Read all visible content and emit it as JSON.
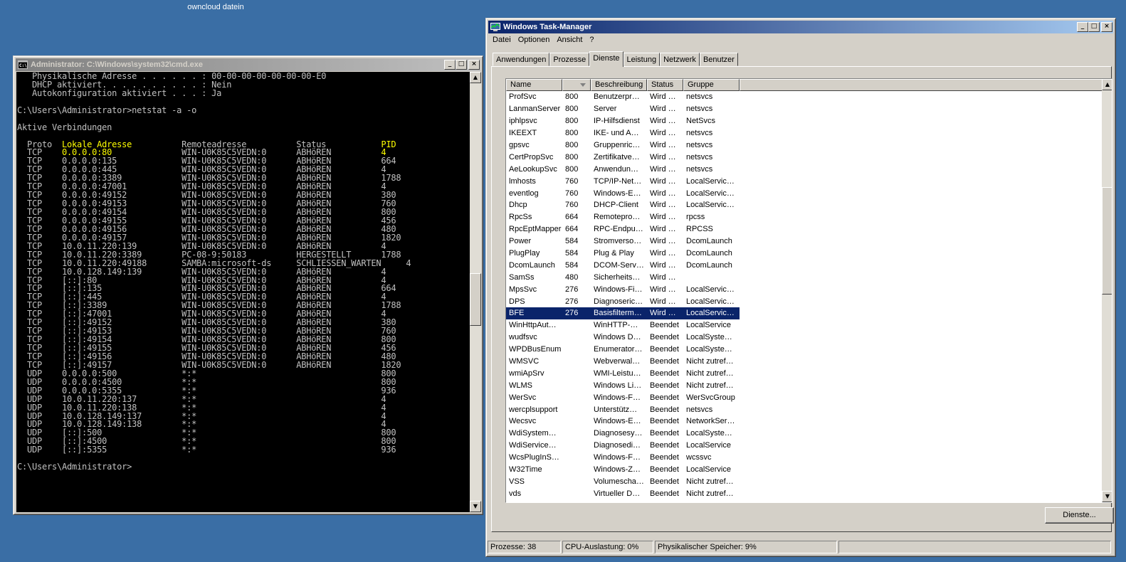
{
  "desktop": {
    "icon_label": "owncloud datein"
  },
  "cmd": {
    "title": "Administrator: C:\\Windows\\system32\\cmd.exe",
    "buttons": {
      "minimize": "_",
      "maximize": "□",
      "close": "×"
    },
    "lines": [
      "   Physikalische Adresse . . . . . . : 00-00-00-00-00-00-00-E0",
      "   DHCP aktiviert. . . . . . . . . . : Nein",
      "   Autokonfiguration aktiviert . . . : Ja",
      "",
      "C:\\Users\\Administrator>netstat -a -o",
      "",
      "Aktive Verbindungen",
      "",
      "  Proto  Lokale Adresse          Remoteadresse          Status           PID",
      "  TCP    0.0.0.0:80              WIN-U0K85C5VEDN:0      ABHöREN          4",
      "  TCP    0.0.0.0:135             WIN-U0K85C5VEDN:0      ABHöREN          664",
      "  TCP    0.0.0.0:445             WIN-U0K85C5VEDN:0      ABHöREN          4",
      "  TCP    0.0.0.0:3389            WIN-U0K85C5VEDN:0      ABHöREN          1788",
      "  TCP    0.0.0.0:47001           WIN-U0K85C5VEDN:0      ABHöREN          4",
      "  TCP    0.0.0.0:49152           WIN-U0K85C5VEDN:0      ABHöREN          380",
      "  TCP    0.0.0.0:49153           WIN-U0K85C5VEDN:0      ABHöREN          760",
      "  TCP    0.0.0.0:49154           WIN-U0K85C5VEDN:0      ABHöREN          800",
      "  TCP    0.0.0.0:49155           WIN-U0K85C5VEDN:0      ABHöREN          456",
      "  TCP    0.0.0.0:49156           WIN-U0K85C5VEDN:0      ABHöREN          480",
      "  TCP    0.0.0.0:49157           WIN-U0K85C5VEDN:0      ABHöREN          1820",
      "  TCP    10.0.11.220:139         WIN-U0K85C5VEDN:0      ABHöREN          4",
      "  TCP    10.0.11.220:3389        PC-08-9:50183          HERGESTELLT      1788",
      "  TCP    10.0.11.220:49188       SAMBA:microsoft-ds     SCHLIESSEN_WARTEN     4",
      "  TCP    10.0.128.149:139        WIN-U0K85C5VEDN:0      ABHöREN          4",
      "  TCP    [::]:80                 WIN-U0K85C5VEDN:0      ABHöREN          4",
      "  TCP    [::]:135                WIN-U0K85C5VEDN:0      ABHöREN          664",
      "  TCP    [::]:445                WIN-U0K85C5VEDN:0      ABHöREN          4",
      "  TCP    [::]:3389               WIN-U0K85C5VEDN:0      ABHöREN          1788",
      "  TCP    [::]:47001              WIN-U0K85C5VEDN:0      ABHöREN          4",
      "  TCP    [::]:49152              WIN-U0K85C5VEDN:0      ABHöREN          380",
      "  TCP    [::]:49153              WIN-U0K85C5VEDN:0      ABHöREN          760",
      "  TCP    [::]:49154              WIN-U0K85C5VEDN:0      ABHöREN          800",
      "  TCP    [::]:49155              WIN-U0K85C5VEDN:0      ABHöREN          456",
      "  TCP    [::]:49156              WIN-U0K85C5VEDN:0      ABHöREN          480",
      "  TCP    [::]:49157              WIN-U0K85C5VEDN:0      ABHöREN          1820",
      "  UDP    0.0.0.0:500             *:*                                     800",
      "  UDP    0.0.0.0:4500            *:*                                     800",
      "  UDP    0.0.0.0:5355            *:*                                     936",
      "  UDP    10.0.11.220:137         *:*                                     4",
      "  UDP    10.0.11.220:138         *:*                                     4",
      "  UDP    10.0.128.149:137        *:*                                     4",
      "  UDP    10.0.128.149:138        *:*                                     4",
      "  UDP    [::]:500                *:*                                     800",
      "  UDP    [::]:4500               *:*                                     800",
      "  UDP    [::]:5355               *:*                                     936",
      "",
      "C:\\Users\\Administrator>"
    ],
    "highlight": {
      "local_header": "Lokale Adresse",
      "local_value": "0.0.0.0:80",
      "pid_header": "PID",
      "pid_value": "4"
    },
    "colors": {
      "background": "#000000",
      "text": "#c0c0c0",
      "highlight": "#ffff00"
    }
  },
  "taskmanager": {
    "title": "Windows Task-Manager",
    "buttons": {
      "minimize": "_",
      "maximize": "□",
      "close": "×"
    },
    "menu": [
      "Datei",
      "Optionen",
      "Ansicht",
      "?"
    ],
    "tabs": [
      "Anwendungen",
      "Prozesse",
      "Dienste",
      "Leistung",
      "Netzwerk",
      "Benutzer"
    ],
    "active_tab": "Dienste",
    "columns": [
      "Name",
      "",
      "Beschreibung",
      "Status",
      "Gruppe"
    ],
    "rows": [
      [
        "ProfSvc",
        "800",
        "Benutzerpr…",
        "Wird …",
        "netsvcs"
      ],
      [
        "LanmanServer",
        "800",
        "Server",
        "Wird …",
        "netsvcs"
      ],
      [
        "iphlpsvc",
        "800",
        "IP-Hilfsdienst",
        "Wird …",
        "NetSvcs"
      ],
      [
        "IKEEXT",
        "800",
        "IKE- und A…",
        "Wird …",
        "netsvcs"
      ],
      [
        "gpsvc",
        "800",
        "Gruppenric…",
        "Wird …",
        "netsvcs"
      ],
      [
        "CertPropSvc",
        "800",
        "Zertifikatve…",
        "Wird …",
        "netsvcs"
      ],
      [
        "AeLookupSvc",
        "800",
        "Anwendun…",
        "Wird …",
        "netsvcs"
      ],
      [
        "lmhosts",
        "760",
        "TCP/IP-Net…",
        "Wird …",
        "LocalServic…"
      ],
      [
        "eventlog",
        "760",
        "Windows-E…",
        "Wird …",
        "LocalServic…"
      ],
      [
        "Dhcp",
        "760",
        "DHCP-Client",
        "Wird …",
        "LocalServic…"
      ],
      [
        "RpcSs",
        "664",
        "Remotepro…",
        "Wird …",
        "rpcss"
      ],
      [
        "RpcEptMapper",
        "664",
        "RPC-Endpu…",
        "Wird …",
        "RPCSS"
      ],
      [
        "Power",
        "584",
        "Stromverso…",
        "Wird …",
        "DcomLaunch"
      ],
      [
        "PlugPlay",
        "584",
        "Plug & Play",
        "Wird …",
        "DcomLaunch"
      ],
      [
        "DcomLaunch",
        "584",
        "DCOM-Serv…",
        "Wird …",
        "DcomLaunch"
      ],
      [
        "SamSs",
        "480",
        "Sicherheits…",
        "Wird …",
        ""
      ],
      [
        "MpsSvc",
        "276",
        "Windows-Fi…",
        "Wird …",
        "LocalServic…"
      ],
      [
        "DPS",
        "276",
        "Diagnoseric…",
        "Wird …",
        "LocalServic…"
      ],
      [
        "BFE",
        "276",
        "Basisfilterm…",
        "Wird …",
        "LocalServic…"
      ],
      [
        "WinHttpAut…",
        "",
        "WinHTTP-…",
        "Beendet",
        "LocalService"
      ],
      [
        "wudfsvc",
        "",
        "Windows D…",
        "Beendet",
        "LocalSyste…"
      ],
      [
        "WPDBusEnum",
        "",
        "Enumerator…",
        "Beendet",
        "LocalSyste…"
      ],
      [
        "WMSVC",
        "",
        "Webverwal…",
        "Beendet",
        "Nicht zutref…"
      ],
      [
        "wmiApSrv",
        "",
        "WMI-Leistu…",
        "Beendet",
        "Nicht zutref…"
      ],
      [
        "WLMS",
        "",
        "Windows Li…",
        "Beendet",
        "Nicht zutref…"
      ],
      [
        "WerSvc",
        "",
        "Windows-F…",
        "Beendet",
        "WerSvcGroup"
      ],
      [
        "wercplsupport",
        "",
        "Unterstütz…",
        "Beendet",
        "netsvcs"
      ],
      [
        "Wecsvc",
        "",
        "Windows-E…",
        "Beendet",
        "NetworkSer…"
      ],
      [
        "WdiSystem…",
        "",
        "Diagnosesy…",
        "Beendet",
        "LocalSyste…"
      ],
      [
        "WdiService…",
        "",
        "Diagnosedi…",
        "Beendet",
        "LocalService"
      ],
      [
        "WcsPlugInS…",
        "",
        "Windows-F…",
        "Beendet",
        "wcssvc"
      ],
      [
        "W32Time",
        "",
        "Windows-Z…",
        "Beendet",
        "LocalService"
      ],
      [
        "VSS",
        "",
        "Volumescha…",
        "Beendet",
        "Nicht zutref…"
      ],
      [
        "vds",
        "",
        "Virtueller D…",
        "Beendet",
        "Nicht zutref…"
      ]
    ],
    "selected_row": "BFE",
    "services_button": "Dienste...",
    "status": {
      "processes": "Prozesse: 38",
      "cpu": "CPU-Auslastung: 0%",
      "memory": "Physikalischer Speicher: 9%"
    },
    "colors": {
      "selection": "#0a246a",
      "title_active": "#0a246a"
    }
  }
}
